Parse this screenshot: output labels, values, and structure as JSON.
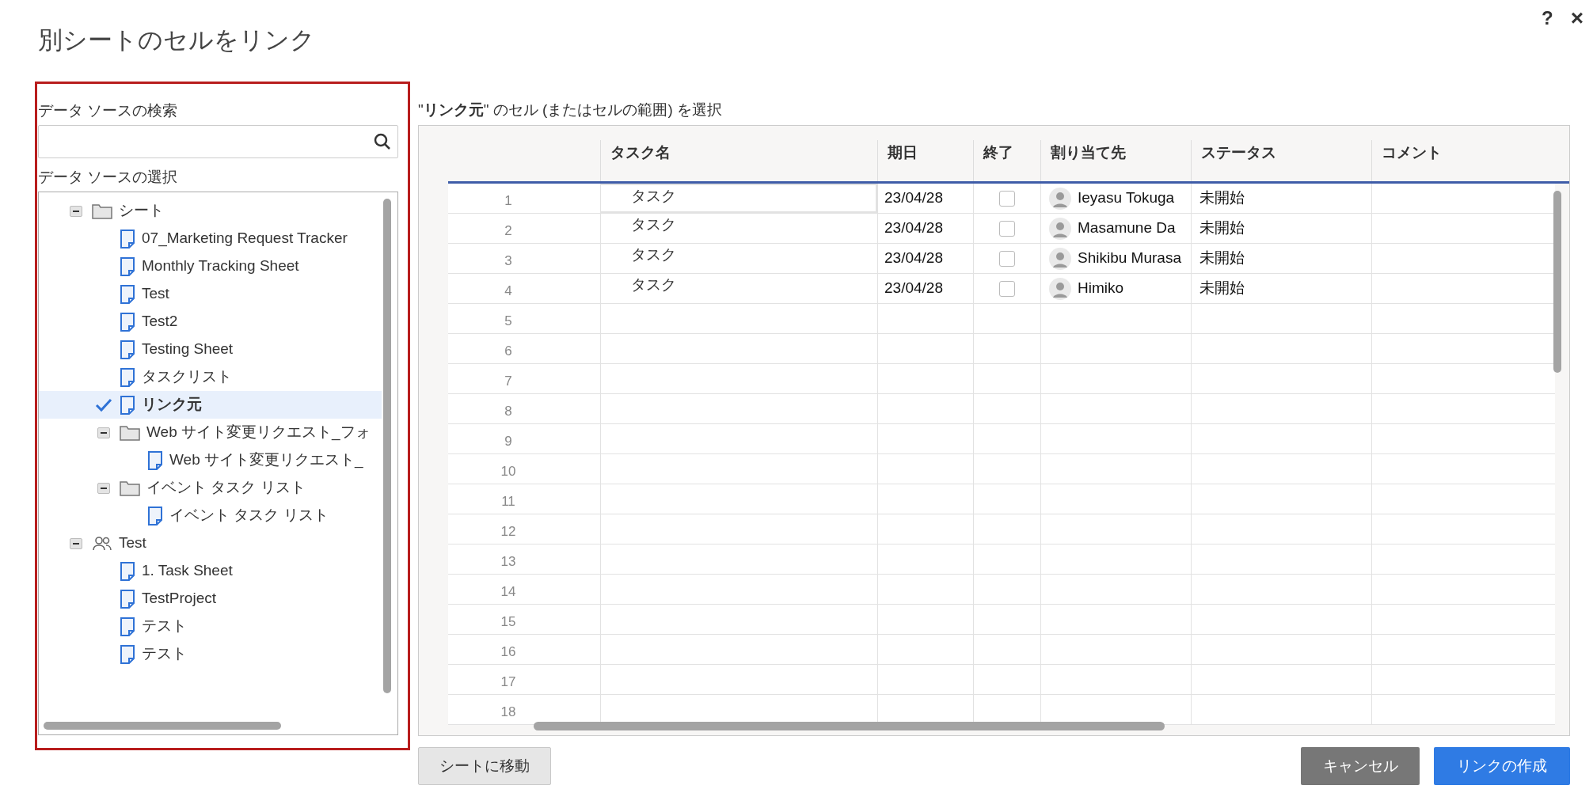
{
  "dialog": {
    "title": "別シートのセルをリンク",
    "help": "?",
    "close": "×"
  },
  "search": {
    "label": "データ ソースの検索"
  },
  "source": {
    "label": "データ ソースの選択",
    "tree": [
      {
        "kind": "folder",
        "label": "シート",
        "expanded": true,
        "selected": false,
        "children": [
          {
            "kind": "sheet",
            "label": "07_Marketing Request Tracker",
            "selected": false
          },
          {
            "kind": "sheet",
            "label": "Monthly Tracking Sheet",
            "selected": false
          },
          {
            "kind": "sheet",
            "label": "Test",
            "selected": false
          },
          {
            "kind": "sheet",
            "label": "Test2",
            "selected": false
          },
          {
            "kind": "sheet",
            "label": "Testing Sheet",
            "selected": false
          },
          {
            "kind": "sheet",
            "label": "タスクリスト",
            "selected": false
          },
          {
            "kind": "sheet",
            "label": "リンク元",
            "selected": true
          },
          {
            "kind": "folder",
            "label": "Web サイト変更リクエスト_フォ",
            "expanded": true,
            "selected": false,
            "children": [
              {
                "kind": "sheet",
                "label": "Web サイト変更リクエスト_",
                "selected": false
              }
            ]
          },
          {
            "kind": "folder",
            "label": "イベント タスク リスト",
            "expanded": true,
            "selected": false,
            "children": [
              {
                "kind": "sheet",
                "label": "イベント タスク リスト",
                "selected": false
              }
            ]
          }
        ]
      },
      {
        "kind": "workspace",
        "label": "Test",
        "expanded": true,
        "selected": false,
        "children": [
          {
            "kind": "sheet",
            "label": "1. Task Sheet",
            "selected": false
          },
          {
            "kind": "sheet",
            "label": "TestProject",
            "selected": false
          },
          {
            "kind": "sheet",
            "label": "テスト",
            "selected": false
          },
          {
            "kind": "sheet",
            "label": "テスト",
            "selected": false
          }
        ]
      }
    ]
  },
  "grid": {
    "caption": "\"**リンク元**\" のセル (またはセルの範囲) を選択",
    "columns": [
      "タスク名",
      "期日",
      "終了",
      "割り当て先",
      "ステータス",
      "コメント"
    ],
    "rows": [
      {
        "number": "1",
        "task": "タスク",
        "due": "23/04/28",
        "done": false,
        "assignee": "Ieyasu Tokuga",
        "status": "未開始",
        "selected": true
      },
      {
        "number": "2",
        "task": "タスク",
        "due": "23/04/28",
        "done": false,
        "assignee": "Masamune Da",
        "status": "未開始",
        "selected": false
      },
      {
        "number": "3",
        "task": "タスク",
        "due": "23/04/28",
        "done": false,
        "assignee": "Shikibu Murasa",
        "status": "未開始",
        "selected": false
      },
      {
        "number": "4",
        "task": "タスク",
        "due": "23/04/28",
        "done": false,
        "assignee": "Himiko",
        "status": "未開始",
        "selected": false
      },
      {
        "number": "5",
        "selected": false
      },
      {
        "number": "6",
        "selected": false
      },
      {
        "number": "7",
        "selected": false
      },
      {
        "number": "8",
        "selected": false
      },
      {
        "number": "9",
        "selected": false
      },
      {
        "number": "10",
        "selected": false
      },
      {
        "number": "11",
        "selected": false
      },
      {
        "number": "12",
        "selected": false
      },
      {
        "number": "13",
        "selected": false
      },
      {
        "number": "14",
        "selected": false
      },
      {
        "number": "15",
        "selected": false
      },
      {
        "number": "16",
        "selected": false
      },
      {
        "number": "17",
        "selected": false
      },
      {
        "number": "18",
        "selected": false
      }
    ]
  },
  "buttons": {
    "move": "シートに移動",
    "cancel": "キャンセル",
    "create": "リンクの作成"
  }
}
